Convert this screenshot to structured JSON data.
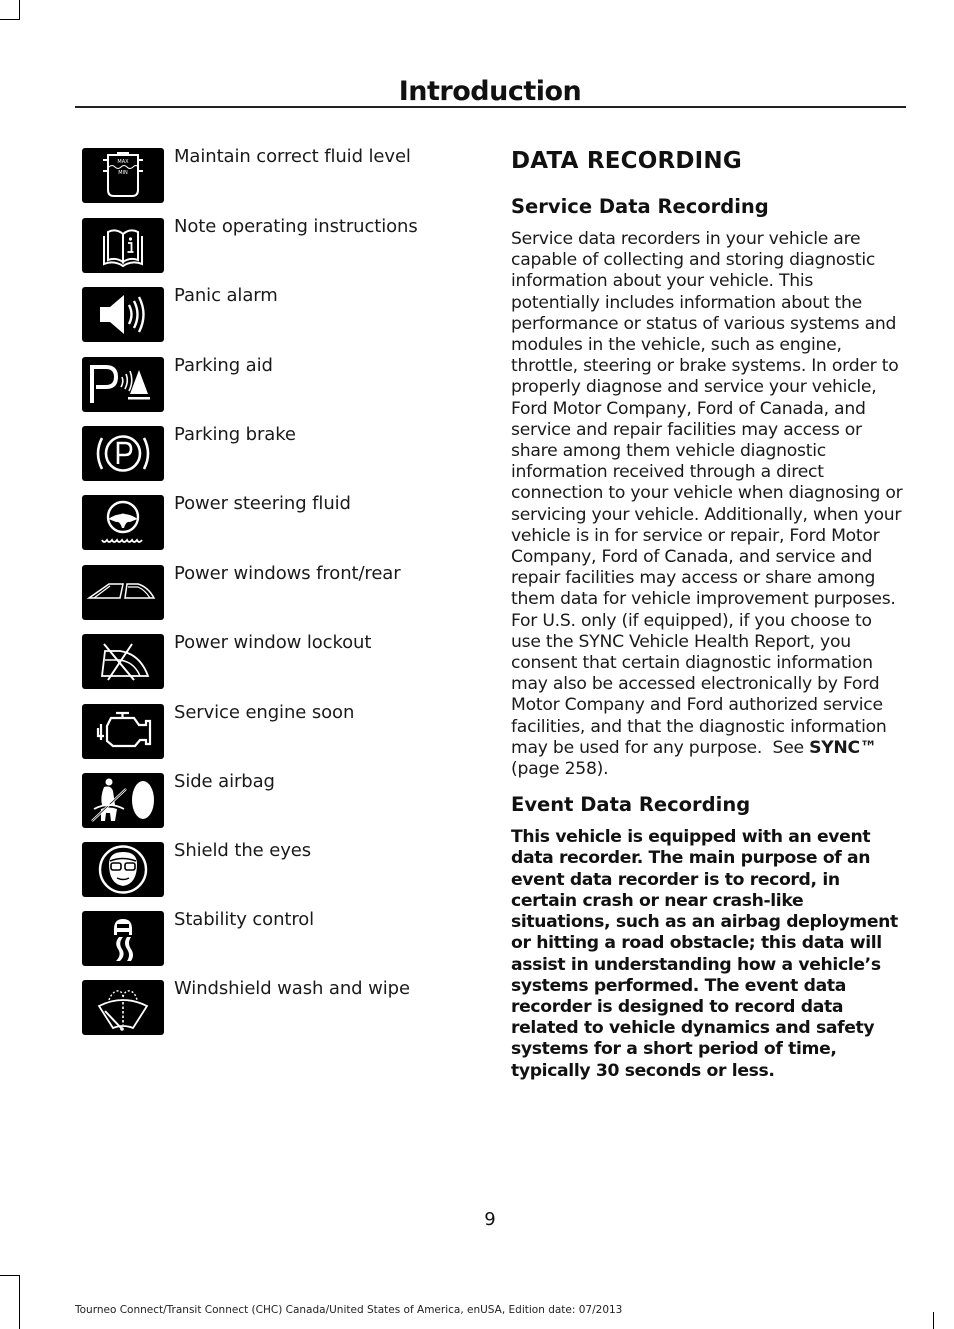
{
  "header": {
    "title": "Introduction"
  },
  "symbols": [
    {
      "icon": "fluid-level-icon",
      "label": "Maintain correct fluid level",
      "max_text": "MAX",
      "min_text": "MIN"
    },
    {
      "icon": "operating-instructions-icon",
      "label": "Note operating instructions"
    },
    {
      "icon": "panic-alarm-icon",
      "label": "Panic alarm"
    },
    {
      "icon": "parking-aid-icon",
      "label": "Parking aid"
    },
    {
      "icon": "parking-brake-icon",
      "label": "Parking brake"
    },
    {
      "icon": "power-steering-fluid-icon",
      "label": "Power steering fluid"
    },
    {
      "icon": "power-windows-icon",
      "label": "Power windows front/rear"
    },
    {
      "icon": "power-window-lockout-icon",
      "label": "Power window lockout"
    },
    {
      "icon": "service-engine-icon",
      "label": "Service engine soon"
    },
    {
      "icon": "side-airbag-icon",
      "label": "Side airbag"
    },
    {
      "icon": "shield-eyes-icon",
      "label": "Shield the eyes"
    },
    {
      "icon": "stability-control-icon",
      "label": "Stability control"
    },
    {
      "icon": "windshield-wash-wipe-icon",
      "label": "Windshield wash and wipe"
    }
  ],
  "content": {
    "section_title": "DATA RECORDING",
    "service": {
      "heading": "Service Data Recording",
      "body": "Service data recorders in your vehicle are capable of collecting and storing diagnostic information about your vehicle. This potentially includes information about the performance or status of various systems and modules in the vehicle, such as engine, throttle, steering or brake systems. In order to properly diagnose and service your vehicle, Ford Motor Company, Ford of Canada, and service and repair facilities may access or share among them vehicle diagnostic information received through a direct connection to your vehicle when diagnosing or servicing your vehicle. Additionally, when your vehicle is in for service or repair, Ford Motor Company, Ford of Canada, and service and repair facilities may access or share among them data for vehicle improvement purposes. For U.S. only (if equipped), if you choose to use the SYNC Vehicle Health Report, you consent that certain diagnostic information may also be accessed electronically by Ford Motor Company and Ford authorized service facilities, and that the diagnostic information may be used for any purpose.",
      "see_prefix": "See",
      "see_link": "SYNC™",
      "see_suffix": "(page 258)."
    },
    "event": {
      "heading": "Event Data Recording",
      "body": "This vehicle is equipped with an event data recorder. The main purpose of an event data recorder is to record, in certain crash or near crash-like situations, such as an airbag deployment or hitting a road obstacle; this data will assist in understanding how a vehicle’s systems performed. The event data recorder is designed to record data related to vehicle dynamics and safety systems for a short period of time, typically 30 seconds or less."
    }
  },
  "footer": {
    "page_number": "9",
    "edition_text": "Tourneo Connect/Transit Connect (CHC) Canada/United States of America, enUSA, Edition date: 07/2013"
  }
}
